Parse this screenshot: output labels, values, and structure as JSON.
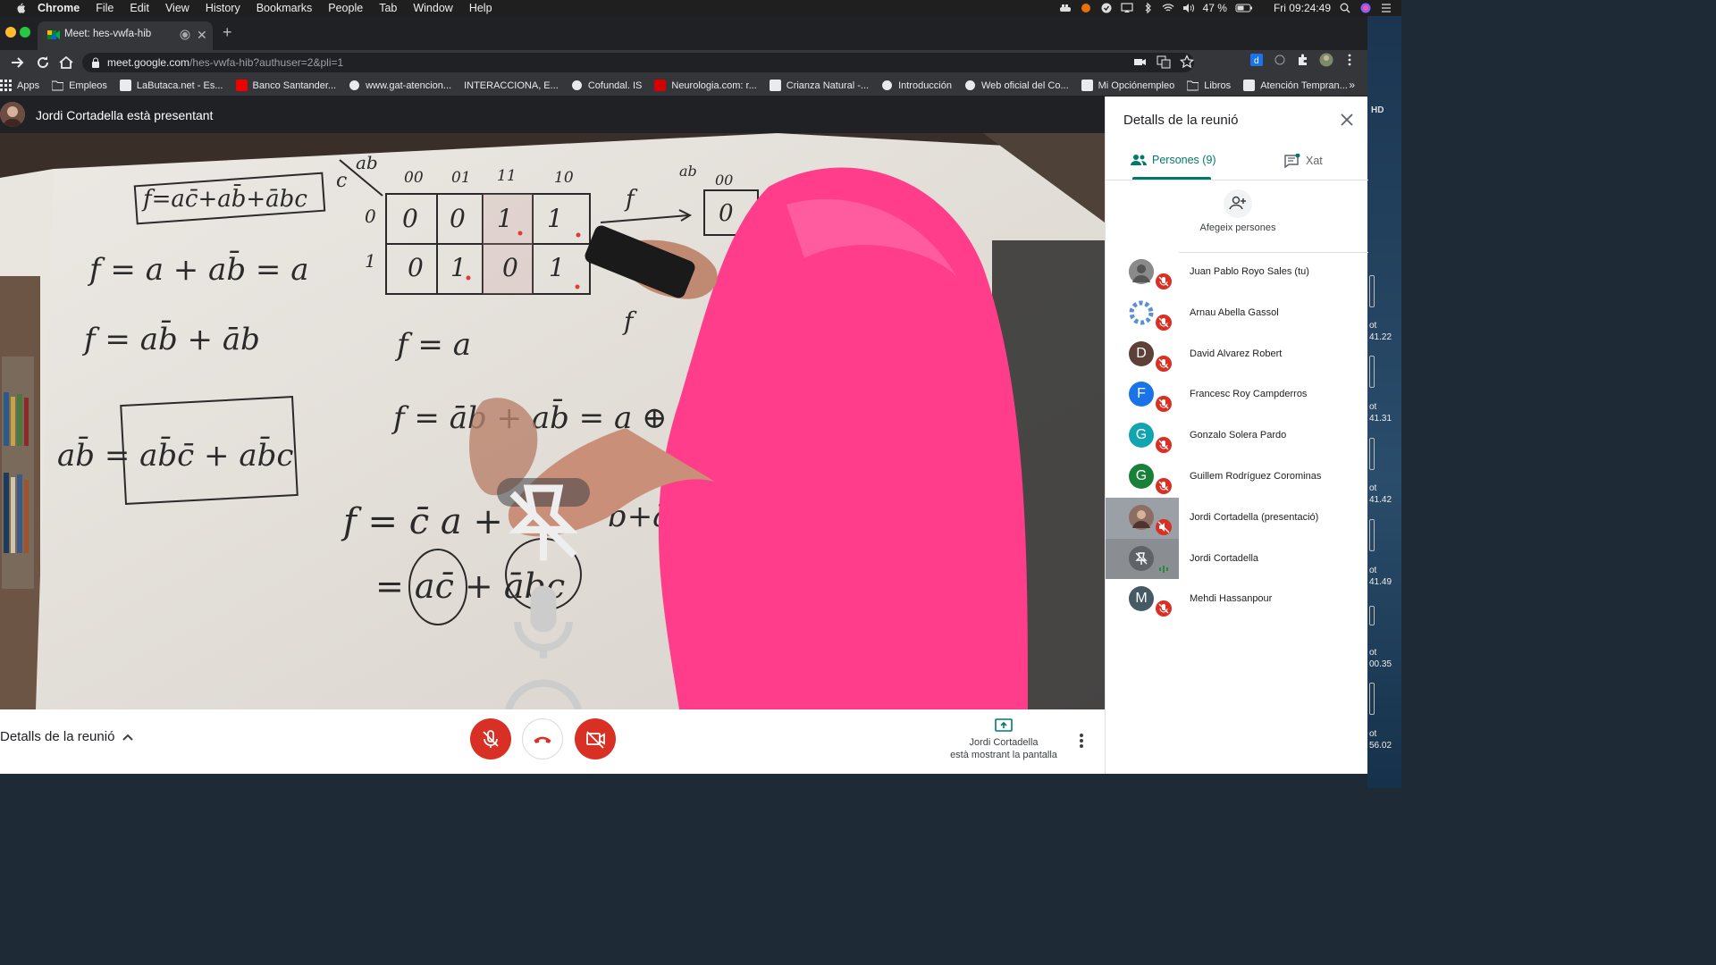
{
  "menubar": {
    "app": "Chrome",
    "items": [
      "File",
      "Edit",
      "View",
      "History",
      "Bookmarks",
      "People",
      "Tab",
      "Window",
      "Help"
    ],
    "battery": "47 %",
    "clock": "Fri 09:24:49"
  },
  "tab": {
    "title": "Meet: hes-vwfa-hib"
  },
  "omnibox": {
    "host": "meet.google.com",
    "path": "/hes-vwfa-hib?authuser=2&pli=1"
  },
  "bookmarks": [
    "Apps",
    "Empleos",
    "LaButaca.net - Es...",
    "Banco Santander...",
    "www.gat-atencion...",
    "INTERACCIONA, E...",
    "Cofundal. IS",
    "Neurologia.com: r...",
    "Crianza Natural -...",
    "Introducción",
    "Web oficial del Co...",
    "Mi Opciónempleo",
    "Libros",
    "Atención Tempran..."
  ],
  "bookmarks_more": "»",
  "presenter": {
    "label": "Jordi Cortadella està presentant"
  },
  "video": {
    "board_eq_box": "f=ac̄+ab̄+ābc",
    "cd": "c",
    "ab": "ab",
    "cols": [
      "00",
      "01",
      "11",
      "10"
    ],
    "rows": [
      "0",
      "1"
    ],
    "kmap": [
      [
        "0",
        "0",
        "1",
        "1"
      ],
      [
        "0",
        "1",
        "0",
        "1"
      ]
    ],
    "eq1": "f = a + ab̄ = a",
    "eq2": "f = ab̄ + āb",
    "eq3": "f = a",
    "eq4": "f = āb + ab̄ = a ⊕",
    "eq5": "ab̄ = ab̄c̄ + ab̄c",
    "eq6": "f = c̄ a +",
    "eq7": "b+āb",
    "eq8": "= ac̄ + ābc",
    "fc_label": "f",
    "sub": "c",
    "arrow_f": "f",
    "arrow_zero": "0",
    "arrow_cols": "00",
    "arrow_ab": "ab",
    "kmap2_partial": "0"
  },
  "bottombar": {
    "details": "Detalls de la reunió",
    "present_line1": "Jordi Cortadella",
    "present_line2": "està mostrant la pantalla"
  },
  "panel": {
    "title": "Detalls de la reunió",
    "people_tab": "Persones (9)",
    "chat_tab": "Xat",
    "add_people": "Afegeix persones",
    "people": [
      {
        "name": "Juan Pablo Royo Sales (tu)",
        "initial": "",
        "color": "#9e9e9e"
      },
      {
        "name": "Arnau Abella Gassol",
        "initial": "",
        "color": "#5b8fd8"
      },
      {
        "name": "David Alvarez Robert",
        "initial": "D",
        "color": "#5d4037"
      },
      {
        "name": "Francesc Roy Campderros",
        "initial": "F",
        "color": "#1a73e8"
      },
      {
        "name": "Gonzalo Solera Pardo",
        "initial": "G",
        "color": "#12a4af"
      },
      {
        "name": "Guillem Rodríguez Corominas",
        "initial": "G",
        "color": "#188038"
      },
      {
        "name": "Jordi Cortadella (presentació)",
        "initial": "",
        "color": "#8d6e63"
      },
      {
        "name": "Jordi Cortadella",
        "initial": "",
        "color": "#5f6368"
      },
      {
        "name": "Mehdi Hassanpour",
        "initial": "M",
        "color": "#455a64"
      }
    ]
  },
  "desktop": {
    "label": "HD",
    "shots": [
      {
        "a": "ot",
        "b": "41.22"
      },
      {
        "a": "ot",
        "b": "41.31"
      },
      {
        "a": "ot",
        "b": "41.42"
      },
      {
        "a": "ot",
        "b": "41.49"
      },
      {
        "a": "ot",
        "b": "00.35"
      },
      {
        "a": "ot",
        "b": "56.02"
      }
    ]
  },
  "colors": {
    "red": "#d93025",
    "teal": "#00796b",
    "pink": "#ff3d8a"
  }
}
